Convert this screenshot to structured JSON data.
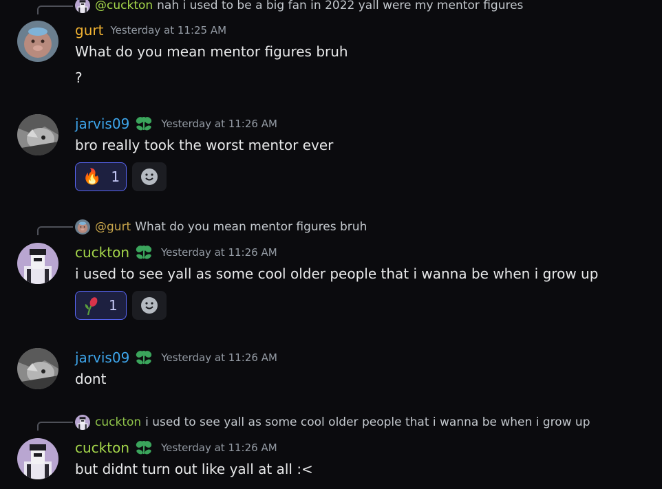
{
  "colors": {
    "background": "#0b0b0e",
    "cuckton": "#a6d84b",
    "gurt": "#f0b232",
    "jarvis09": "#3ea6ec",
    "timestamp": "#949ba4",
    "reaction_border": "#5865f2",
    "badge": "#3ba55c"
  },
  "messages": [
    {
      "reply": {
        "author": "@cuckton",
        "text": "nah i used to be a big fan in 2022 yall were my mentor figures"
      },
      "author": "gurt",
      "timestamp": "Yesterday at 11:25 AM",
      "lines": [
        "What do you mean mentor figures bruh",
        "?"
      ]
    },
    {
      "author": "jarvis09",
      "badge_icon": "flower-badge-icon",
      "timestamp": "Yesterday at 11:26 AM",
      "lines": [
        "bro really took the worst mentor ever"
      ],
      "reaction": {
        "emoji": "🔥",
        "count": "1"
      }
    },
    {
      "reply": {
        "author": "@gurt",
        "text": "What do you mean mentor figures bruh"
      },
      "author": "cuckton",
      "badge_icon": "flower-badge-icon",
      "timestamp": "Yesterday at 11:26 AM",
      "lines": [
        "i used to see yall as some cool older people that i wanna be when i grow up"
      ],
      "reaction": {
        "emoji": "wilted-rose",
        "count": "1"
      }
    },
    {
      "author": "jarvis09",
      "badge_icon": "flower-badge-icon",
      "timestamp": "Yesterday at 11:26 AM",
      "lines": [
        "dont"
      ]
    },
    {
      "reply": {
        "author": "cuckton",
        "text": "i used to see yall as some cool older people that i wanna be when i grow up"
      },
      "author": "cuckton",
      "badge_icon": "flower-badge-icon",
      "timestamp": "Yesterday at 11:26 AM",
      "lines": [
        "but didnt turn out like yall at all :<"
      ]
    }
  ]
}
